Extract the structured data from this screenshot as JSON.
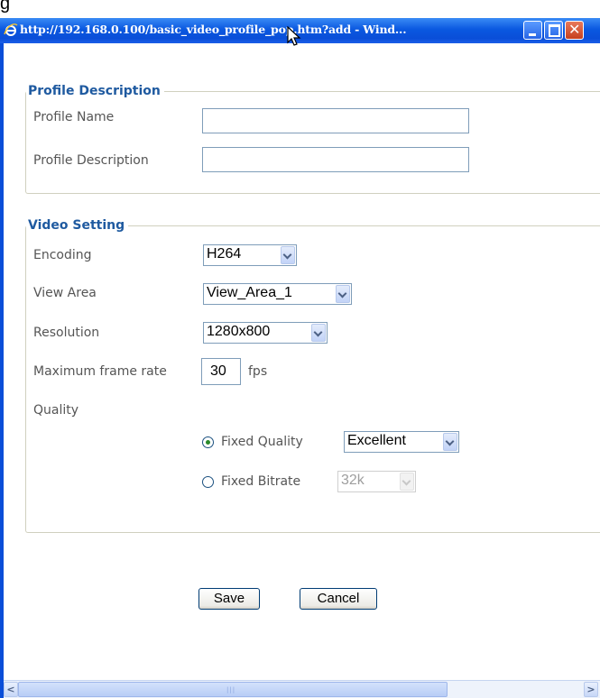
{
  "top_fragment": "g",
  "window": {
    "title": "http://192.168.0.100/basic_video_profile_pop.htm?add - Wind...",
    "icon": "ie-icon",
    "close_glyph": "✕",
    "colors": {
      "titlebar": "#0a58e0",
      "close": "#c6401e"
    }
  },
  "profile": {
    "legend": "Profile Description",
    "name_label": "Profile Name",
    "name_value": "",
    "desc_label": "Profile Description",
    "desc_value": ""
  },
  "video": {
    "legend": "Video Setting",
    "encoding_label": "Encoding",
    "encoding_value": "H264",
    "view_area_label": "View Area",
    "view_area_value": "View_Area_1",
    "resolution_label": "Resolution",
    "resolution_value": "1280x800",
    "frame_rate_label": "Maximum frame rate",
    "frame_rate_value": "30",
    "frame_rate_unit": "fps",
    "quality_label": "Quality",
    "fixed_quality_label": "Fixed Quality",
    "fixed_quality_value": "Excellent",
    "fixed_quality_selected": true,
    "fixed_bitrate_label": "Fixed Bitrate",
    "fixed_bitrate_value": "32k",
    "fixed_bitrate_selected": false
  },
  "buttons": {
    "save": "Save",
    "cancel": "Cancel"
  },
  "scrollbar": {
    "left_arrow": "<",
    "right_arrow": ">",
    "grip": "|||"
  }
}
